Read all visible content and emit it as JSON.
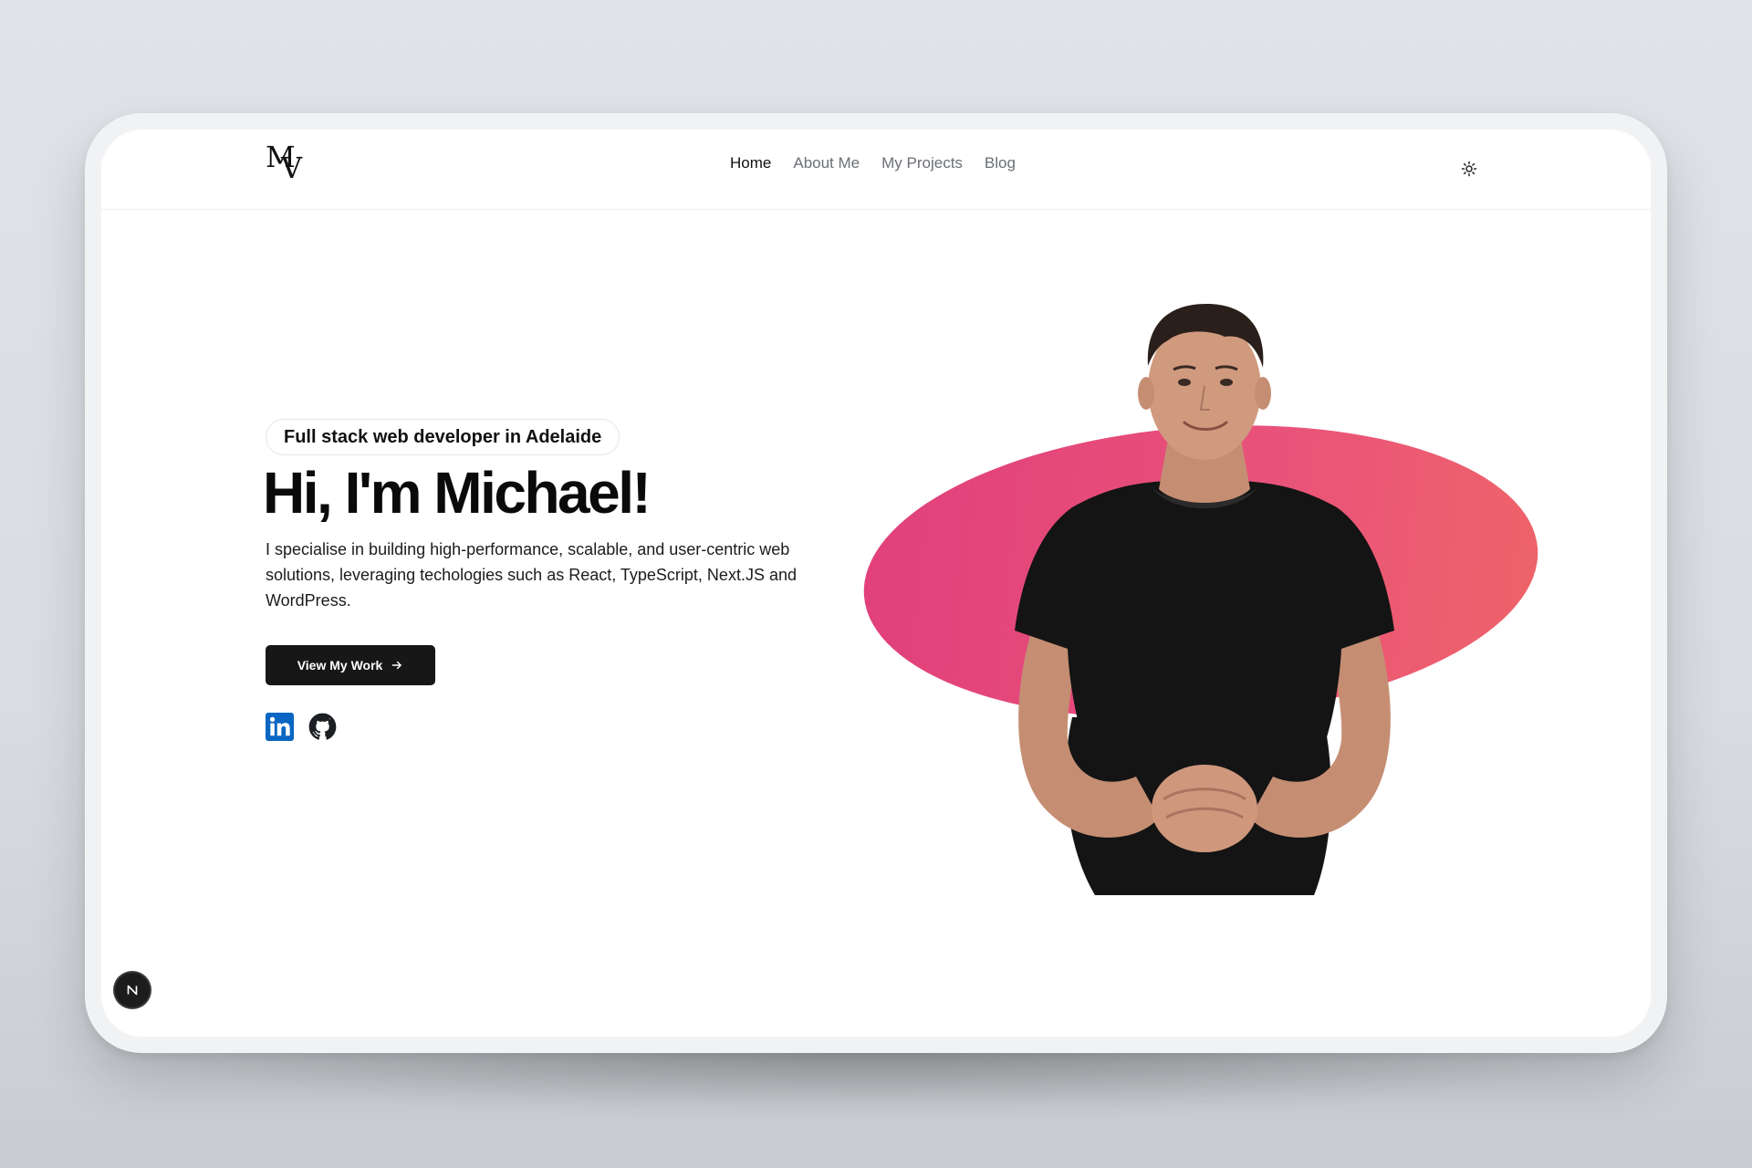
{
  "header": {
    "logo_text_m": "M",
    "logo_text_v": "V",
    "nav": [
      {
        "label": "Home",
        "active": true
      },
      {
        "label": "About Me",
        "active": false
      },
      {
        "label": "My Projects",
        "active": false
      },
      {
        "label": "Blog",
        "active": false
      }
    ],
    "theme_toggle_icon": "sun-icon"
  },
  "hero": {
    "badge": "Full stack web developer in Adelaide",
    "headline": "Hi, I'm Michael!",
    "intro": "I specialise in building high-performance, scalable, and user-centric web solutions, leveraging techologies such as React, TypeScript, Next.JS and WordPress.",
    "cta_label": "View My Work",
    "cta_icon": "arrow-right-icon",
    "socials": [
      {
        "icon": "linkedin-icon"
      },
      {
        "icon": "github-icon"
      }
    ],
    "blob_colors": [
      "#e13f7b",
      "#ef6468"
    ]
  },
  "dev_indicator": {
    "icon": "nextjs-icon",
    "label": "N"
  },
  "colors": {
    "background": "#dfe2e6",
    "button": "#171717",
    "linkedin": "#0a66c2",
    "accent_pink": "#e9537a"
  }
}
